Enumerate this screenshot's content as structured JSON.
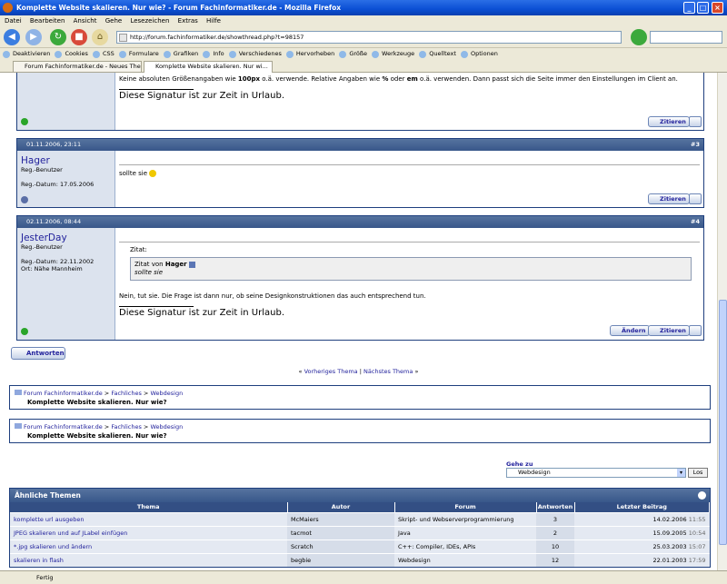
{
  "window": {
    "title": "Komplette Website skalieren. Nur wie? - Forum Fachinformatiker.de - Mozilla Firefox"
  },
  "menu": [
    "Datei",
    "Bearbeiten",
    "Ansicht",
    "Gehe",
    "Lesezeichen",
    "Extras",
    "Hilfe"
  ],
  "url": "http://forum.fachinformatiker.de/showthread.php?t=98157",
  "bookmarks": [
    "Deaktivieren",
    "Cookies",
    "CSS",
    "Formulare",
    "Grafiken",
    "Info",
    "Verschiedenes",
    "Hervorheben",
    "Größe",
    "Werkzeuge",
    "Quelltext",
    "Optionen"
  ],
  "tabs": [
    {
      "label": "Forum Fachinformatiker.de - Neues Thema ..."
    },
    {
      "label": "Komplette Website skalieren. Nur wi..."
    }
  ],
  "post1": {
    "text_pre": "Keine absoluten Größenangaben wie ",
    "b1": "100px",
    "text_mid": " o.ä. verwende. Relative Angaben wie ",
    "b2": "%",
    "text_or": " oder ",
    "b3": "em",
    "text_post": " o.ä. verwenden. Dann passt sich die Seite immer den Einstellungen im Client an.",
    "signature": "Diese Signatur ist zur Zeit in Urlaub.",
    "quote_button": "Zitieren"
  },
  "post3": {
    "date": "01.11.2006, 23:11",
    "number": "#3",
    "username": "Hager",
    "usertitle": "Reg.-Benutzer",
    "regdate": "Reg.-Datum: 17.05.2006",
    "message": "sollte sie",
    "quote_button": "Zitieren"
  },
  "post4": {
    "date": "02.11.2006, 08:44",
    "number": "#4",
    "username": "JesterDay",
    "usertitle": "Reg.-Benutzer",
    "regdate": "Reg.-Datum: 22.11.2002",
    "location": "Ort: Nähe Mannheim",
    "quote_label": "Zitat:",
    "quote_from": "Zitat von ",
    "quote_author": "Hager",
    "quote_text": "sollte sie",
    "message": "Nein, tut sie. Die Frage ist dann nur, ob seine Designkonstruktionen das auch entsprechend tun.",
    "signature": "Diese Signatur ist zur Zeit in Urlaub.",
    "edit_button": "Ändern",
    "quote_button": "Zitieren"
  },
  "reply_button": "Antworten",
  "thread_nav": {
    "prev": "Vorheriges Thema",
    "sep": "|",
    "next": "Nächstes Thema",
    "left": "«",
    "right": "»"
  },
  "breadcrumb": {
    "forum": "Forum Fachinformatiker.de",
    "sep": ">",
    "cat": "Fachliches",
    "sub": "Webdesign",
    "thread": "Komplette Website skalieren. Nur wie?"
  },
  "goto": {
    "label": "Gehe zu",
    "selected": "Webdesign",
    "button": "Los"
  },
  "similar": {
    "title": "Ähnliche Themen",
    "columns": [
      "Thema",
      "Autor",
      "Forum",
      "Antworten",
      "Letzter Beitrag"
    ],
    "rows": [
      {
        "thema": "komplette url ausgeben",
        "autor": "McMaiers",
        "forum": "Skript- und Webserverprogrammierung",
        "antworten": "3",
        "datum": "14.02.2006",
        "zeit": "11:55"
      },
      {
        "thema": "JPEG skalieren und auf JLabel einfügen",
        "autor": "tacmot",
        "forum": "Java",
        "antworten": "2",
        "datum": "15.09.2005",
        "zeit": "10:54"
      },
      {
        "thema": "*.jpg skalieren und ändern",
        "autor": "Scratch",
        "forum": "C++: Compiler, IDEs, APIs",
        "antworten": "10",
        "datum": "25.03.2003",
        "zeit": "15:07"
      },
      {
        "thema": "skalieren in flash",
        "autor": "begbie",
        "forum": "Webdesign",
        "antworten": "12",
        "datum": "22.01.2003",
        "zeit": "17:59"
      }
    ]
  },
  "status": "Fertig"
}
